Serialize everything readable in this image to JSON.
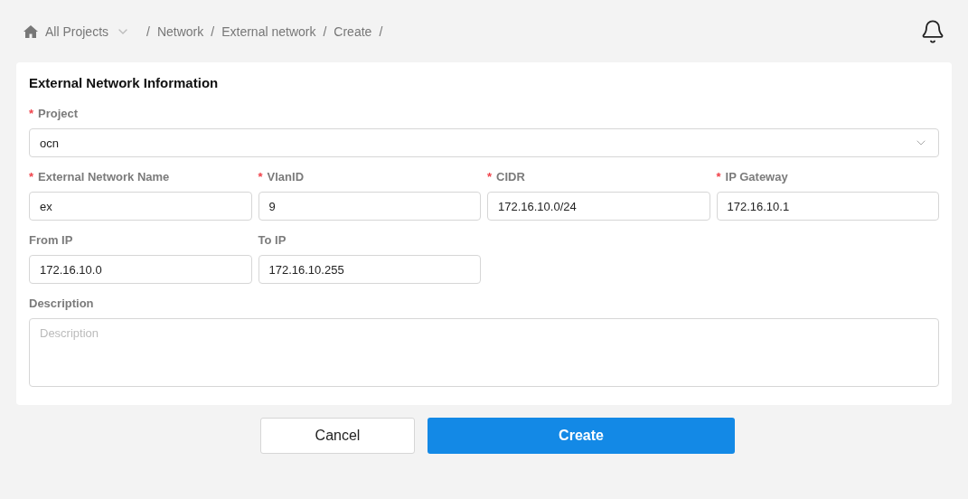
{
  "breadcrumb": [
    {
      "label": "All Projects",
      "kind": "dropdown",
      "separator": "/"
    },
    {
      "label": "Network",
      "kind": "link",
      "separator": "/"
    },
    {
      "label": "External network",
      "kind": "link",
      "separator": "/"
    },
    {
      "label": "Create",
      "kind": "link",
      "separator": "/"
    }
  ],
  "form": {
    "title": "External Network Information",
    "rows": [
      [
        {
          "label": "Project",
          "mark": "*",
          "kind": "select",
          "value": "ocn"
        }
      ],
      [
        {
          "label": "External Network Name",
          "mark": "*",
          "kind": "text",
          "value": "ex"
        },
        {
          "label": "VlanID",
          "mark": "*",
          "kind": "text",
          "value": "9"
        },
        {
          "label": "CIDR",
          "mark": "*",
          "kind": "text",
          "value": "172.16.10.0/24"
        },
        {
          "label": "IP Gateway",
          "mark": "*",
          "kind": "text",
          "value": "172.16.10.1"
        }
      ],
      [
        {
          "label": "From IP",
          "kind": "text",
          "value": "172.16.10.0"
        },
        {
          "label": "To IP",
          "kind": "text",
          "value": "172.16.10.255"
        }
      ],
      [
        {
          "label": "Description",
          "kind": "textarea",
          "placeholder": "Description"
        }
      ]
    ]
  },
  "buttons": [
    {
      "label": "Cancel",
      "kind": "secondary"
    },
    {
      "label": "Create",
      "kind": "primary"
    }
  ]
}
